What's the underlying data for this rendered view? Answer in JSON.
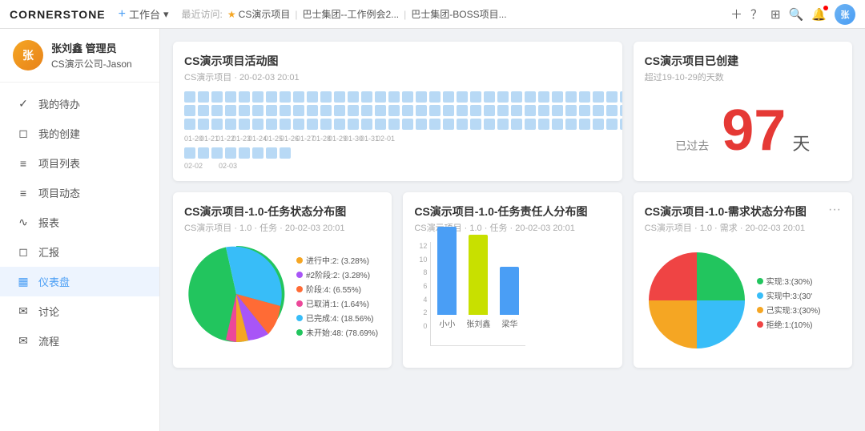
{
  "app": {
    "logo": "CORNERSTONE",
    "workbench_label": "工作台",
    "recent_label": "最近访问:",
    "recent_items": [
      {
        "star": true,
        "text": "CS演示项目"
      },
      {
        "star": false,
        "text": "巴士集团--工作例会2..."
      },
      {
        "star": false,
        "text": "巴士集团-BOSS项目..."
      }
    ]
  },
  "sidebar": {
    "user": {
      "name": "张刘鑫 管理员",
      "company": "CS演示公司-Jason"
    },
    "items": [
      {
        "icon": "✓",
        "label": "我的待办",
        "active": false
      },
      {
        "icon": "◻",
        "label": "我的创建",
        "active": false
      },
      {
        "icon": "≡",
        "label": "项目列表",
        "active": false
      },
      {
        "icon": "≡",
        "label": "项目动态",
        "active": false
      },
      {
        "icon": "∿",
        "label": "报表",
        "active": false
      },
      {
        "icon": "◻",
        "label": "汇报",
        "active": false
      },
      {
        "icon": "▦",
        "label": "仪表盘",
        "active": true
      },
      {
        "icon": "✉",
        "label": "讨论",
        "active": false
      },
      {
        "icon": "✉",
        "label": "流程",
        "active": false
      }
    ]
  },
  "cards": {
    "activity": {
      "title": "CS演示项目活动图",
      "subtitle": "CS演示项目 · 20-02-03 20:01"
    },
    "creation": {
      "title": "CS演示项目已创建",
      "subtitle": "超过19-10-29的天数",
      "prefix": "已过去",
      "days": "97",
      "suffix": "天"
    },
    "task_status": {
      "title": "CS演示项目-1.0-任务状态分布图",
      "subtitle": "CS演示项目 · 1.0 · 任务 · 20-02-03 20:01",
      "legend": [
        {
          "label": "进行中:2: (3.28%)",
          "color": "#f5a623"
        },
        {
          "label": "#2阶段:2: (3.28%)",
          "color": "#a855f7"
        },
        {
          "label": "阶段:4: (6.55%)",
          "color": "#ff6b35"
        },
        {
          "label": "已取消:1: (1.64%)",
          "color": "#ec4899"
        },
        {
          "label": "已完成:4: (18.56%)",
          "color": "#38bdf8"
        },
        {
          "label": "未开始:48: (78.69%)",
          "color": "#22c55e"
        }
      ],
      "segments": [
        {
          "value": 78.69,
          "color": "#22c55e"
        },
        {
          "value": 18.56,
          "color": "#38bdf8"
        },
        {
          "value": 6.55,
          "color": "#ff6b35"
        },
        {
          "value": 3.28,
          "color": "#a855f7"
        },
        {
          "value": 3.28,
          "color": "#f5a623"
        },
        {
          "value": 1.64,
          "color": "#ec4899"
        }
      ]
    },
    "task_assignee": {
      "title": "CS演示项目-1.0-任务责任人分布图",
      "subtitle": "CS演示项目 · 1.0 · 任务 · 20-02-03 20:01",
      "bars": [
        {
          "label": "小小",
          "value": 11,
          "color": "#4a9ef5"
        },
        {
          "label": "张刘鑫",
          "value": 10,
          "color": "#f5e642"
        },
        {
          "label": "梁华",
          "value": 6,
          "color": "#4a9ef5"
        }
      ],
      "y_labels": [
        "0",
        "2",
        "4",
        "6",
        "8",
        "10",
        "12"
      ]
    },
    "requirement_status": {
      "title": "CS演示项目-1.0-需求状态分布图",
      "subtitle": "CS演示项目 · 1.0 · 需求 · 20-02-03 20:01",
      "legend": [
        {
          "label": "实现:3:(30%)",
          "color": "#22c55e"
        },
        {
          "label": "实现中:3:(30'",
          "color": "#38bdf8"
        },
        {
          "label": "己实现:3:(30%)",
          "color": "#f5a623"
        },
        {
          "label": "拒绝:1:(10%)",
          "color": "#ef4444"
        }
      ],
      "segments": [
        {
          "value": 30,
          "color": "#22c55e"
        },
        {
          "value": 30,
          "color": "#38bdf8"
        },
        {
          "value": 30,
          "color": "#f5a623"
        },
        {
          "value": 10,
          "color": "#ef4444"
        }
      ]
    }
  },
  "heatmap": {
    "dates_row1": [
      "01-20",
      "01-21",
      "01-22",
      "01-23",
      "01-24",
      "01-25",
      "01-26",
      "01-27",
      "01-28",
      "01-29",
      "01-30",
      "01-31",
      "02-01"
    ],
    "dates_row2": [
      "02-02",
      "02-03"
    ]
  }
}
